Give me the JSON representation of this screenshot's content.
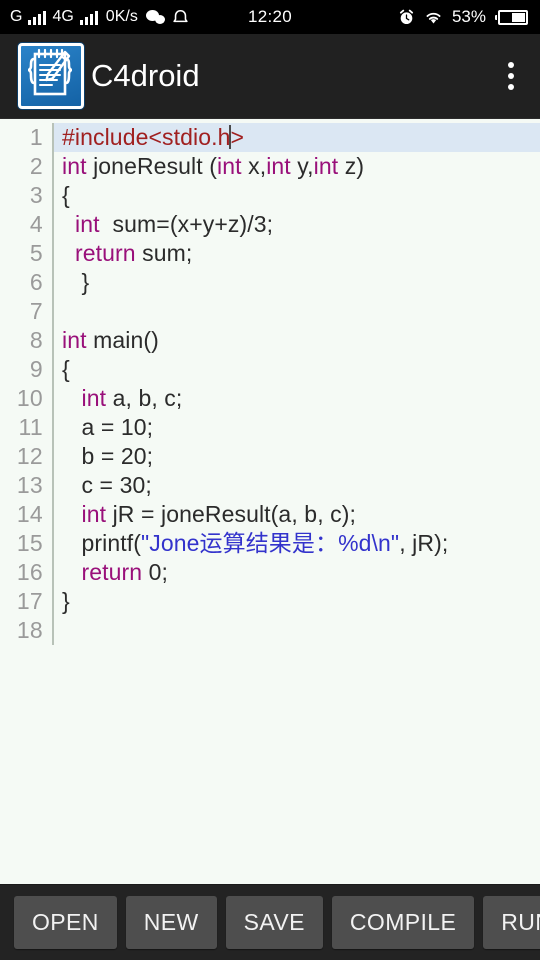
{
  "statusbar": {
    "network_type": "G",
    "network_type_2": "4G",
    "data_speed": "0K/s",
    "clock": "12:20",
    "battery_percent": "53%",
    "icons": [
      "signal-bars-icon",
      "signal-bars-icon",
      "wechat-icon",
      "bell-icon",
      "alarm-icon",
      "wifi-icon",
      "battery-icon"
    ]
  },
  "appbar": {
    "title": "C4droid",
    "icon": "c4droid-app-icon",
    "overflow": "overflow-menu-icon"
  },
  "editor": {
    "active_line": 1,
    "lines": [
      {
        "n": "1",
        "tokens": [
          {
            "t": "#include<stdio.h",
            "c": "pre"
          },
          {
            "t": "cursor",
            "c": "cursor"
          },
          {
            "t": ">",
            "c": "pre"
          }
        ]
      },
      {
        "n": "2",
        "tokens": [
          {
            "t": "int",
            "c": "kw"
          },
          {
            "t": " joneResult (",
            "c": ""
          },
          {
            "t": "int",
            "c": "kw"
          },
          {
            "t": " x,",
            "c": ""
          },
          {
            "t": "int",
            "c": "kw"
          },
          {
            "t": " y,",
            "c": ""
          },
          {
            "t": "int",
            "c": "kw"
          },
          {
            "t": " z)",
            "c": ""
          }
        ]
      },
      {
        "n": "3",
        "tokens": [
          {
            "t": "{",
            "c": ""
          }
        ]
      },
      {
        "n": "4",
        "tokens": [
          {
            "t": "  ",
            "c": ""
          },
          {
            "t": "int",
            "c": "kw"
          },
          {
            "t": "  sum=(x+y+z)/3;",
            "c": ""
          }
        ]
      },
      {
        "n": "5",
        "tokens": [
          {
            "t": "  ",
            "c": ""
          },
          {
            "t": "return",
            "c": "kw"
          },
          {
            "t": " sum;",
            "c": ""
          }
        ]
      },
      {
        "n": "6",
        "tokens": [
          {
            "t": "   }",
            "c": ""
          }
        ]
      },
      {
        "n": "7",
        "tokens": [
          {
            "t": "",
            "c": ""
          }
        ]
      },
      {
        "n": "8",
        "tokens": [
          {
            "t": "int",
            "c": "kw"
          },
          {
            "t": " main()",
            "c": ""
          }
        ]
      },
      {
        "n": "9",
        "tokens": [
          {
            "t": "{",
            "c": ""
          }
        ]
      },
      {
        "n": "10",
        "tokens": [
          {
            "t": "   ",
            "c": ""
          },
          {
            "t": "int",
            "c": "kw"
          },
          {
            "t": " a, b, c;",
            "c": ""
          }
        ]
      },
      {
        "n": "11",
        "tokens": [
          {
            "t": "   a = 10;",
            "c": ""
          }
        ]
      },
      {
        "n": "12",
        "tokens": [
          {
            "t": "   b = 20;",
            "c": ""
          }
        ]
      },
      {
        "n": "13",
        "tokens": [
          {
            "t": "   c = 30;",
            "c": ""
          }
        ]
      },
      {
        "n": "14",
        "tokens": [
          {
            "t": "   ",
            "c": ""
          },
          {
            "t": "int",
            "c": "kw"
          },
          {
            "t": " jR = joneResult(a, b, c);",
            "c": ""
          }
        ]
      },
      {
        "n": "15",
        "tokens": [
          {
            "t": "   printf(",
            "c": ""
          },
          {
            "t": "\"Jone运算结果是：%d\\n\"",
            "c": "str"
          },
          {
            "t": ", jR);",
            "c": ""
          }
        ]
      },
      {
        "n": "16",
        "tokens": [
          {
            "t": "   ",
            "c": ""
          },
          {
            "t": "return",
            "c": "kw"
          },
          {
            "t": " 0;",
            "c": ""
          }
        ]
      },
      {
        "n": "17",
        "tokens": [
          {
            "t": "}",
            "c": ""
          }
        ]
      },
      {
        "n": "18",
        "tokens": [
          {
            "t": "",
            "c": ""
          }
        ]
      }
    ],
    "colors": {
      "background": "#f5faf5",
      "active_line_background": "#dbe7f3",
      "keyword": "#99107a",
      "preprocessor": "#a02020",
      "string": "#3333cc",
      "text": "#2b2b2b",
      "line_number": "#9a9a9a"
    }
  },
  "toolbar": {
    "buttons": [
      {
        "label": "OPEN",
        "name": "open-button"
      },
      {
        "label": "NEW",
        "name": "new-button"
      },
      {
        "label": "SAVE",
        "name": "save-button"
      },
      {
        "label": "COMPILE",
        "name": "compile-button"
      },
      {
        "label": "RUN",
        "name": "run-button"
      }
    ]
  }
}
